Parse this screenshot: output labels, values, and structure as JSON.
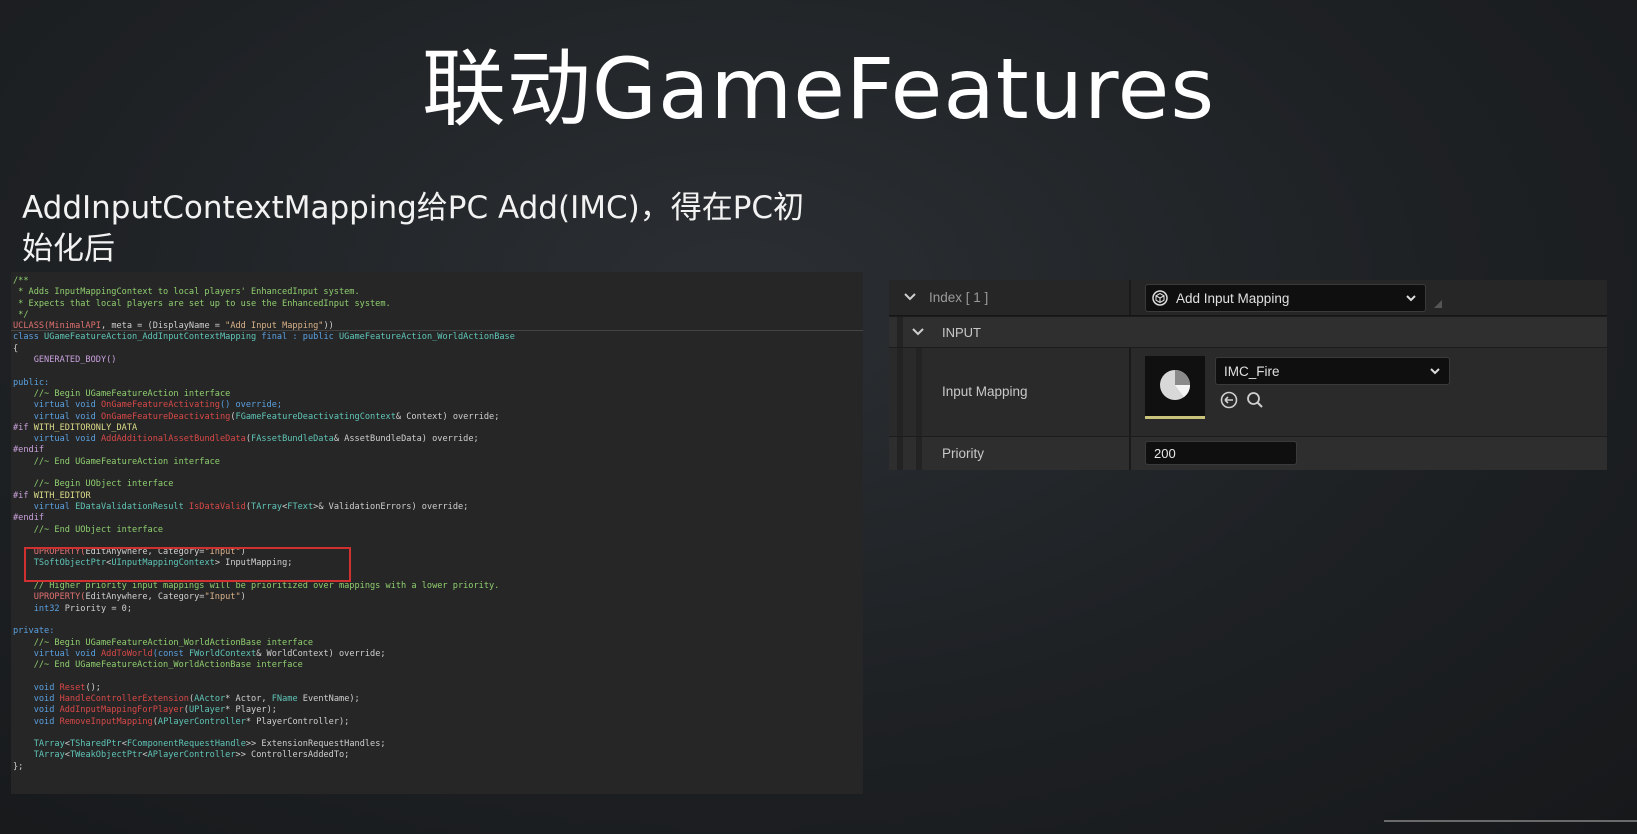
{
  "slide": {
    "title": "联动GameFeatures",
    "subtitle": "AddInputContextMapping给PC Add(IMC)，得在PC初始化后"
  },
  "code": {
    "lines": [
      [
        {
          "t": "/**",
          "c": "c-com"
        }
      ],
      [
        {
          "t": " * Adds InputMappingContext to local players' EnhancedInput system.",
          "c": "c-com"
        }
      ],
      [
        {
          "t": " * Expects that local players are set up to use the EnhancedInput system.",
          "c": "c-com"
        }
      ],
      [
        {
          "t": " */",
          "c": "c-com"
        }
      ],
      [
        {
          "t": "UCLASS(",
          "c": "c-mac"
        },
        {
          "t": "MinimalAPI",
          "c": "c-mac"
        },
        {
          "t": ", meta = (DisplayName = ",
          "c": "c-def"
        },
        {
          "t": "\"Add Input Mapping\"",
          "c": "c-str"
        },
        {
          "t": "))",
          "c": "c-def"
        }
      ],
      [
        {
          "t": "class ",
          "c": "c-kw"
        },
        {
          "t": "UGameFeatureAction_AddInputContextMapping",
          "c": "c-ty"
        },
        {
          "t": " final : ",
          "c": "c-kw"
        },
        {
          "t": "public ",
          "c": "c-kw"
        },
        {
          "t": "UGameFeatureAction_WorldActionBase",
          "c": "c-ty"
        }
      ],
      [
        {
          "t": "{",
          "c": "c-def"
        }
      ],
      [
        {
          "t": "    GENERATED_BODY()",
          "c": "c-pp"
        }
      ],
      [
        {
          "t": "",
          "c": "c-def"
        }
      ],
      [
        {
          "t": "public:",
          "c": "c-kw"
        }
      ],
      [
        {
          "t": "    //~ Begin UGameFeatureAction interface",
          "c": "c-com"
        }
      ],
      [
        {
          "t": "    virtual void ",
          "c": "c-kw"
        },
        {
          "t": "OnGameFeatureActivating",
          "c": "c-fn"
        },
        {
          "t": "() override;",
          "c": "c-kw"
        }
      ],
      [
        {
          "t": "    virtual void ",
          "c": "c-kw"
        },
        {
          "t": "OnGameFeatureDeactivating",
          "c": "c-fn"
        },
        {
          "t": "(",
          "c": "c-def"
        },
        {
          "t": "FGameFeatureDeactivatingContext",
          "c": "c-ty"
        },
        {
          "t": "& Context) override;",
          "c": "c-def"
        }
      ],
      [
        {
          "t": "#if ",
          "c": "c-pp"
        },
        {
          "t": "WITH_EDITORONLY_DATA",
          "c": "c-yel"
        }
      ],
      [
        {
          "t": "    virtual void ",
          "c": "c-kw"
        },
        {
          "t": "AddAdditionalAssetBundleData",
          "c": "c-fn"
        },
        {
          "t": "(",
          "c": "c-def"
        },
        {
          "t": "FAssetBundleData",
          "c": "c-ty"
        },
        {
          "t": "& AssetBundleData) override;",
          "c": "c-def"
        }
      ],
      [
        {
          "t": "#endif",
          "c": "c-pp"
        }
      ],
      [
        {
          "t": "    //~ End UGameFeatureAction interface",
          "c": "c-com"
        }
      ],
      [
        {
          "t": "",
          "c": "c-def"
        }
      ],
      [
        {
          "t": "    //~ Begin UObject interface",
          "c": "c-com"
        }
      ],
      [
        {
          "t": "#if ",
          "c": "c-pp"
        },
        {
          "t": "WITH_EDITOR",
          "c": "c-yel"
        }
      ],
      [
        {
          "t": "    virtual ",
          "c": "c-kw"
        },
        {
          "t": "EDataValidationResult ",
          "c": "c-ty"
        },
        {
          "t": "IsDataValid",
          "c": "c-fn"
        },
        {
          "t": "(",
          "c": "c-def"
        },
        {
          "t": "TArray",
          "c": "c-ty"
        },
        {
          "t": "<",
          "c": "c-def"
        },
        {
          "t": "FText",
          "c": "c-ty"
        },
        {
          "t": ">& ValidationErrors) override;",
          "c": "c-def"
        }
      ],
      [
        {
          "t": "#endif",
          "c": "c-pp"
        }
      ],
      [
        {
          "t": "    //~ End UObject interface",
          "c": "c-com"
        }
      ],
      [
        {
          "t": "",
          "c": "c-def"
        }
      ],
      [
        {
          "t": "    UPROPERTY(",
          "c": "c-mac"
        },
        {
          "t": "EditAnywhere, Category=",
          "c": "c-def"
        },
        {
          "t": "\"Input\"",
          "c": "c-str"
        },
        {
          "t": ")",
          "c": "c-def"
        }
      ],
      [
        {
          "t": "    TSoftObjectPtr",
          "c": "c-ty"
        },
        {
          "t": "<",
          "c": "c-def"
        },
        {
          "t": "UInputMappingContext",
          "c": "c-ty"
        },
        {
          "t": "> InputMapping;",
          "c": "c-def"
        }
      ],
      [
        {
          "t": "",
          "c": "c-def"
        }
      ],
      [
        {
          "t": "    // Higher priority input mappings will be prioritized over mappings with a lower priority.",
          "c": "c-com"
        }
      ],
      [
        {
          "t": "    UPROPERTY(",
          "c": "c-mac"
        },
        {
          "t": "EditAnywhere, Category=",
          "c": "c-def"
        },
        {
          "t": "\"Input\"",
          "c": "c-str"
        },
        {
          "t": ")",
          "c": "c-def"
        }
      ],
      [
        {
          "t": "    int32 ",
          "c": "c-kw"
        },
        {
          "t": "Priority = 0;",
          "c": "c-def"
        }
      ],
      [
        {
          "t": "",
          "c": "c-def"
        }
      ],
      [
        {
          "t": "private:",
          "c": "c-kw"
        }
      ],
      [
        {
          "t": "    //~ Begin UGameFeatureAction_WorldActionBase interface",
          "c": "c-com"
        }
      ],
      [
        {
          "t": "    virtual void ",
          "c": "c-kw"
        },
        {
          "t": "AddToWorld",
          "c": "c-fn"
        },
        {
          "t": "(const ",
          "c": "c-kw"
        },
        {
          "t": "FWorldContext",
          "c": "c-ty"
        },
        {
          "t": "& WorldContext) override;",
          "c": "c-def"
        }
      ],
      [
        {
          "t": "    //~ End UGameFeatureAction_WorldActionBase interface",
          "c": "c-com"
        }
      ],
      [
        {
          "t": "",
          "c": "c-def"
        }
      ],
      [
        {
          "t": "    void ",
          "c": "c-kw"
        },
        {
          "t": "Reset",
          "c": "c-fn"
        },
        {
          "t": "();",
          "c": "c-def"
        }
      ],
      [
        {
          "t": "    void ",
          "c": "c-kw"
        },
        {
          "t": "HandleControllerExtension",
          "c": "c-fn"
        },
        {
          "t": "(",
          "c": "c-def"
        },
        {
          "t": "AActor",
          "c": "c-ty"
        },
        {
          "t": "* Actor, ",
          "c": "c-def"
        },
        {
          "t": "FName",
          "c": "c-ty"
        },
        {
          "t": " EventName);",
          "c": "c-def"
        }
      ],
      [
        {
          "t": "    void ",
          "c": "c-kw"
        },
        {
          "t": "AddInputMappingForPlayer",
          "c": "c-fn"
        },
        {
          "t": "(",
          "c": "c-def"
        },
        {
          "t": "UPlayer",
          "c": "c-ty"
        },
        {
          "t": "* Player);",
          "c": "c-def"
        }
      ],
      [
        {
          "t": "    void ",
          "c": "c-kw"
        },
        {
          "t": "RemoveInputMapping",
          "c": "c-fn"
        },
        {
          "t": "(",
          "c": "c-def"
        },
        {
          "t": "APlayerController",
          "c": "c-ty"
        },
        {
          "t": "* PlayerController);",
          "c": "c-def"
        }
      ],
      [
        {
          "t": "",
          "c": "c-def"
        }
      ],
      [
        {
          "t": "    TArray",
          "c": "c-ty"
        },
        {
          "t": "<",
          "c": "c-def"
        },
        {
          "t": "TSharedPtr",
          "c": "c-ty"
        },
        {
          "t": "<",
          "c": "c-def"
        },
        {
          "t": "FComponentRequestHandle",
          "c": "c-ty"
        },
        {
          "t": ">> ExtensionRequestHandles;",
          "c": "c-def"
        }
      ],
      [
        {
          "t": "    TArray",
          "c": "c-ty"
        },
        {
          "t": "<",
          "c": "c-def"
        },
        {
          "t": "TWeakObjectPtr",
          "c": "c-ty"
        },
        {
          "t": "<",
          "c": "c-def"
        },
        {
          "t": "APlayerController",
          "c": "c-ty"
        },
        {
          "t": ">> ControllersAddedTo;",
          "c": "c-def"
        }
      ],
      [
        {
          "t": "};",
          "c": "c-def"
        }
      ]
    ]
  },
  "details": {
    "index_label": "Index [ 1 ]",
    "action_dropdown": "Add Input Mapping",
    "category": "INPUT",
    "input_mapping_label": "Input Mapping",
    "input_mapping_value": "IMC_Fire",
    "priority_label": "Priority",
    "priority_value": "200"
  },
  "icons": {
    "expand": "chevron-down-icon",
    "asset_thumb": "pie-chart-icon",
    "browse": "arrow-left-circle-icon",
    "find": "search-icon",
    "action": "cube-icon"
  }
}
